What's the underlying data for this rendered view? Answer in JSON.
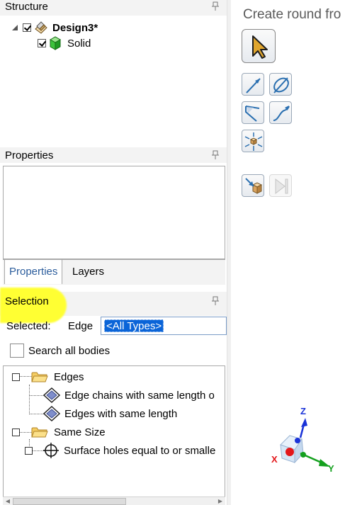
{
  "structure": {
    "title": "Structure",
    "root_label": "Design3*",
    "child_label": "Solid"
  },
  "properties": {
    "title": "Properties",
    "tabs": [
      "Properties",
      "Layers"
    ]
  },
  "selection": {
    "title": "Selection",
    "selected_label": "Selected:",
    "selected_value": "Edge",
    "types_value": "<All Types>",
    "search_label": "Search all bodies",
    "items": [
      "Edges",
      "Edge chains with same length o",
      "Edges with same length",
      "Same Size",
      "Surface holes equal to or smalle"
    ]
  },
  "tool_guide": {
    "title": "Create round fro"
  },
  "triad": {
    "x_label": "X",
    "y_label": "Y",
    "z_label": "Z",
    "colors": {
      "x": "#e3171b",
      "y": "#14a01e",
      "z": "#1a33d8"
    }
  },
  "colors": {
    "highlight": "#ffff33",
    "selection_blue": "#0a64d8",
    "tab_active_text": "#2c5d9c"
  }
}
